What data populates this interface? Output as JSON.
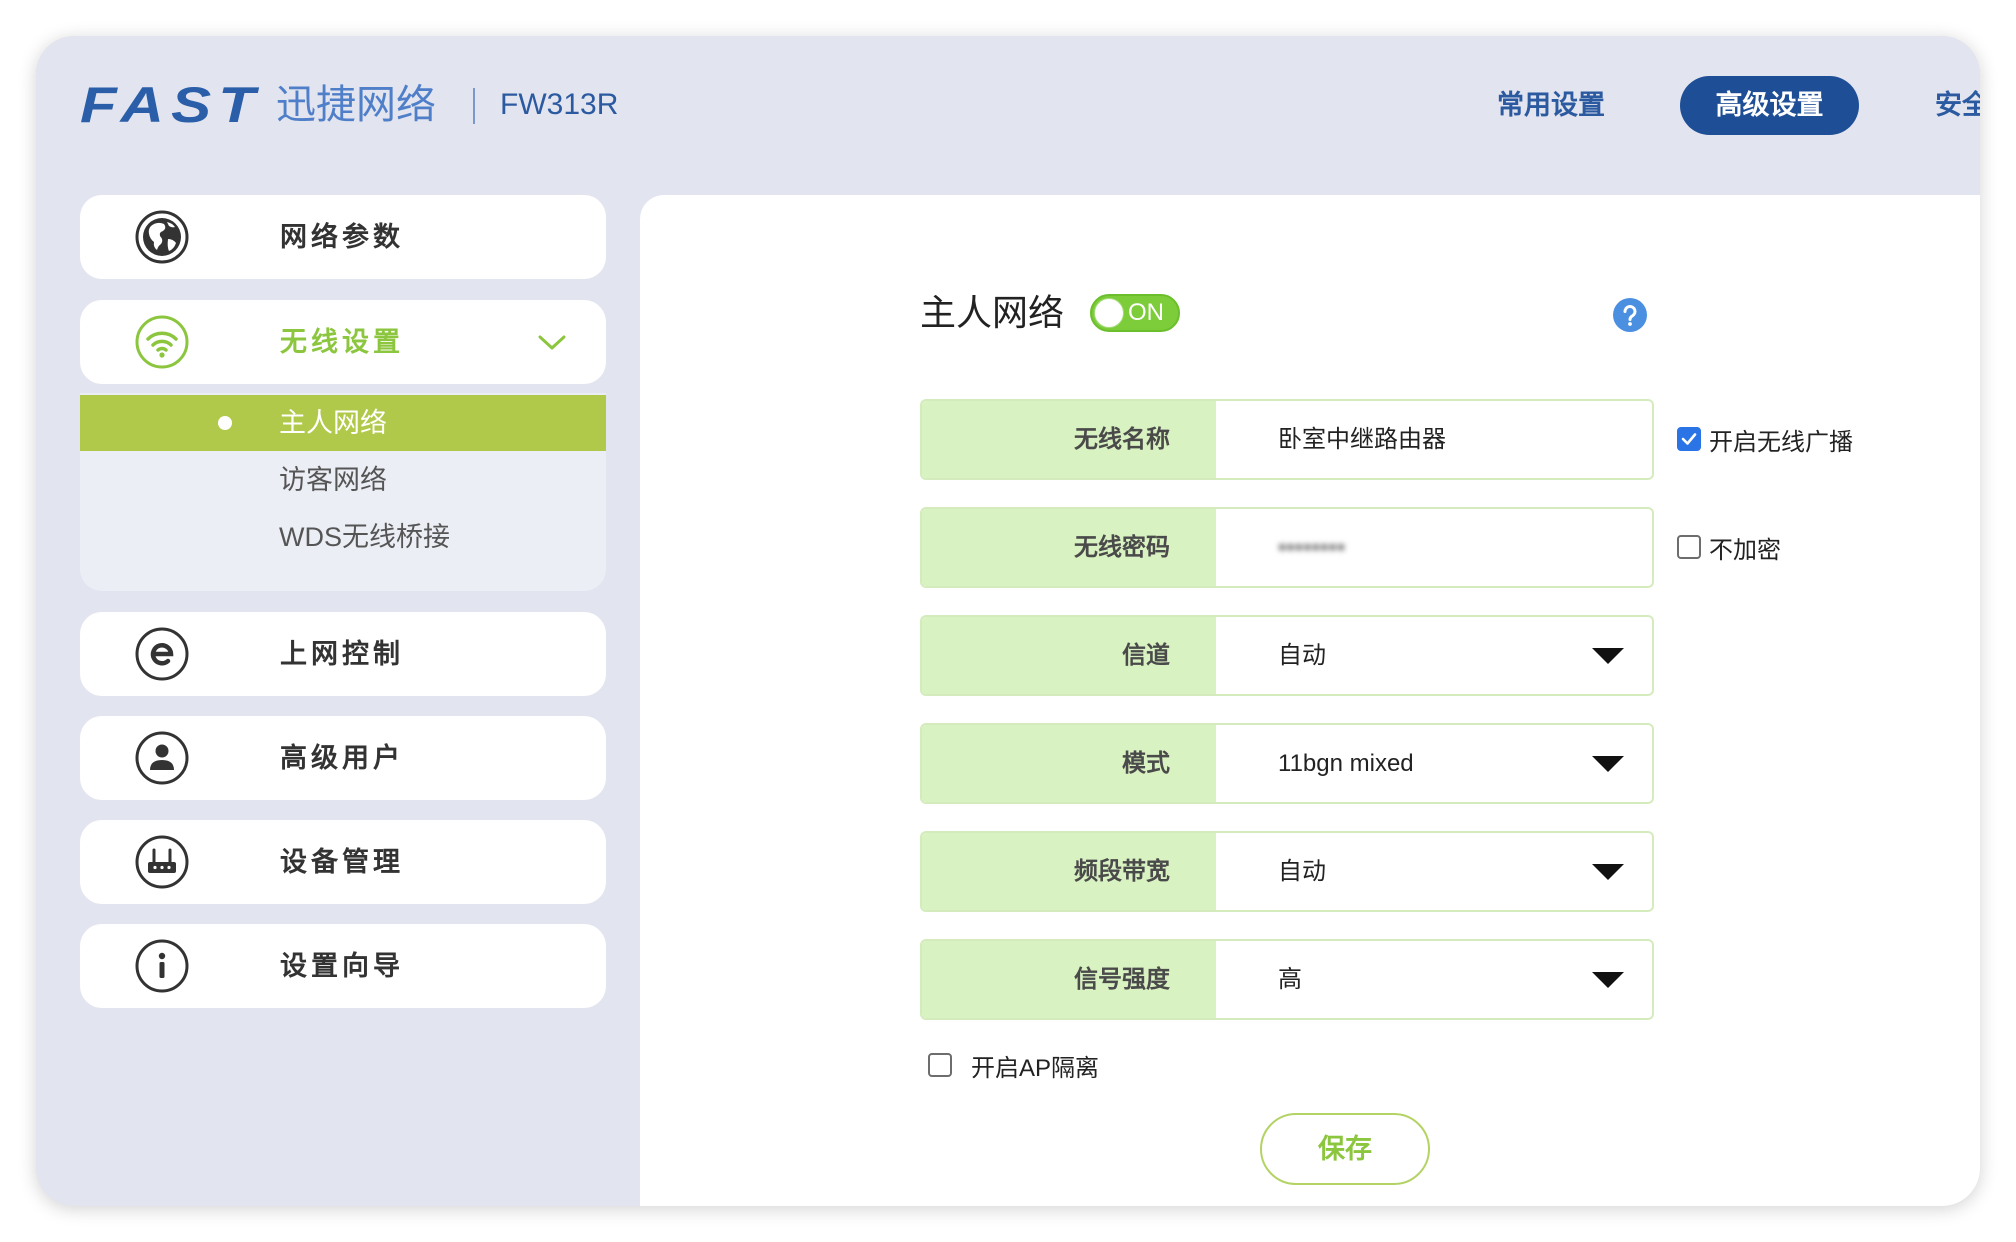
{
  "header": {
    "logo": "FAST",
    "brand_cn": "迅捷网络",
    "model": "FW313R",
    "nav": [
      {
        "label": "常用设置",
        "active": false
      },
      {
        "label": "高级设置",
        "active": true
      },
      {
        "label": "安全",
        "active": false
      }
    ]
  },
  "sidebar": {
    "items": [
      {
        "label": "网络参数",
        "icon": "globe-icon"
      },
      {
        "label": "无线设置",
        "icon": "wifi-icon",
        "expanded": true
      },
      {
        "label": "上网控制",
        "icon": "internet-control-icon"
      },
      {
        "label": "高级用户",
        "icon": "user-icon"
      },
      {
        "label": "设备管理",
        "icon": "router-icon"
      },
      {
        "label": "设置向导",
        "icon": "info-icon"
      }
    ],
    "submenu": [
      {
        "label": "主人网络",
        "active": true
      },
      {
        "label": "访客网络",
        "active": false
      },
      {
        "label": "WDS无线桥接",
        "active": false
      }
    ]
  },
  "main": {
    "title": "主人网络",
    "toggle": {
      "label": "ON",
      "on": true
    },
    "rows": [
      {
        "label": "无线名称",
        "value": "卧室中继路由器"
      },
      {
        "label": "无线密码",
        "value": "••••••••",
        "masked": true
      },
      {
        "label": "信道",
        "value": "自动",
        "dropdown": true
      },
      {
        "label": "模式",
        "value": "11bgn mixed",
        "dropdown": true
      },
      {
        "label": "频段带宽",
        "value": "自动",
        "dropdown": true
      },
      {
        "label": "信号强度",
        "value": "高",
        "dropdown": true
      }
    ],
    "broadcast": {
      "label": "开启无线广播",
      "checked": true
    },
    "no_encryption": {
      "label": "不加密",
      "checked": false
    },
    "ap_isolation": {
      "label": "开启AP隔离",
      "checked": false
    },
    "save_label": "保存"
  },
  "colors": {
    "brand_blue": "#1e4f96",
    "accent_green": "#8cc63f",
    "active_bar": "#b0c94a",
    "label_bg": "#d9f2c2",
    "help_blue": "#4a8fe0",
    "check_blue": "#2a74e6"
  }
}
